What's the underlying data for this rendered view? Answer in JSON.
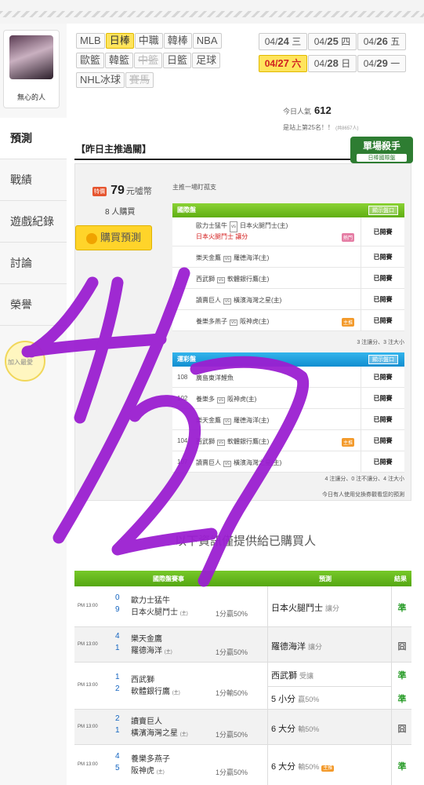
{
  "profile": {
    "name": "無心的人"
  },
  "sidebar": {
    "items": [
      "預測",
      "戰績",
      "遊戲紀錄",
      "討論",
      "榮譽"
    ]
  },
  "bulb_text": "加入最愛",
  "tags": [
    {
      "label": "MLB",
      "state": "normal"
    },
    {
      "label": "日棒",
      "state": "selected"
    },
    {
      "label": "中職",
      "state": "normal"
    },
    {
      "label": "韓棒",
      "state": "normal"
    },
    {
      "label": "NBA",
      "state": "normal"
    },
    {
      "label": "歐籃",
      "state": "normal"
    },
    {
      "label": "韓籃",
      "state": "normal"
    },
    {
      "label": "中籃",
      "state": "disabled"
    },
    {
      "label": "日籃",
      "state": "normal"
    },
    {
      "label": "足球",
      "state": "normal"
    },
    {
      "label": "NHL冰球",
      "state": "normal"
    },
    {
      "label": "賽馬",
      "state": "disabled"
    }
  ],
  "dates": [
    {
      "md": "04/",
      "d": "24",
      "w": "三",
      "sel": false
    },
    {
      "md": "04/",
      "d": "25",
      "w": "四",
      "sel": false
    },
    {
      "md": "04/",
      "d": "26",
      "w": "五",
      "sel": false
    },
    {
      "md": "04/",
      "d": "27",
      "w": "六",
      "sel": true
    },
    {
      "md": "04/",
      "d": "28",
      "w": "日",
      "sel": false
    },
    {
      "md": "04/",
      "d": "29",
      "w": "一",
      "sel": false
    }
  ],
  "popularity": {
    "label": "今日人氣",
    "value": "612"
  },
  "rank": {
    "text": "是站上第25名！！",
    "small": "(共8657人)"
  },
  "section_title": "【昨日主推過關】",
  "badge": {
    "line1": "單場殺手",
    "line2": "日棒國際盤"
  },
  "price": {
    "tag": "特價",
    "value": "79",
    "unit": "元噓幣"
  },
  "bought": "8 人購買",
  "buy_button": "購買預測",
  "intro": "主推一場盯孤支",
  "intl_table": {
    "title": "國際盤",
    "button": "顯示盤口",
    "rows": [
      {
        "away": "歐力士猛牛",
        "home": "日本火腿鬥士(主)",
        "pick": "日本火腿鬥士",
        "type": "讓分",
        "flag": "熱門",
        "status": "已開賽"
      },
      {
        "away": "樂天金鷹",
        "home": "羅德海洋(主)",
        "status": "已開賽"
      },
      {
        "away": "西武獅",
        "home": "軟體銀行鷹(主)",
        "status": "已開賽"
      },
      {
        "away": "讀賣巨人",
        "home": "橫濱海灣之星(主)",
        "status": "已開賽"
      },
      {
        "away": "養樂多燕子",
        "home": "阪神虎(主)",
        "flag": "主推",
        "status": "已開賽"
      }
    ],
    "note": "3 注讓分、3 注大小"
  },
  "lottery_table": {
    "title": "運彩盤",
    "button": "顯示盤口",
    "rows": [
      {
        "no": "108",
        "away": "廣島東洋鯉魚",
        "home": "",
        "status": "已開賽"
      },
      {
        "no": "102",
        "away": "養樂多",
        "home": "阪神虎(主)",
        "status": "已開賽"
      },
      {
        "no": "",
        "away": "樂天金鷹",
        "home": "羅德海洋(主)",
        "status": "已開賽"
      },
      {
        "no": "104",
        "away": "西武獅",
        "home": "軟體銀行鷹(主)",
        "flag": "主推",
        "status": "已開賽"
      },
      {
        "no": "107",
        "away": "讀賣巨人",
        "home": "橫濱海灣之星(主)",
        "status": "已開賽"
      }
    ],
    "note": "4 注讓分、0 注不讓分、4 注大小",
    "exchange_note": "今日有人使用兌換券觀看您的預測"
  },
  "subtitle": "以下資訊僅提供給已購買人",
  "result_table": {
    "headers": [
      "國際盤賽事",
      "預測",
      "結果"
    ],
    "groups": [
      {
        "time": "PM 13:00",
        "s1": "0",
        "t1": "歐力士猛牛",
        "s2": "9",
        "t2": "日本火腿鬥士",
        "home": "(主)",
        "line": "1分贏50%",
        "preds": [
          {
            "text": "日本火腿鬥士",
            "sub": "讓分",
            "result": "準",
            "ok": true
          }
        ]
      },
      {
        "time": "PM 13:00",
        "s1": "4",
        "t1": "樂天金鷹",
        "s2": "1",
        "t2": "羅德海洋",
        "home": "(主)",
        "line": "1分贏50%",
        "preds": [
          {
            "text": "羅德海洋",
            "sub": "讓分",
            "result": "囧",
            "ok": false
          }
        ]
      },
      {
        "time": "PM 13:00",
        "s1": "1",
        "t1": "西武獅",
        "s2": "2",
        "t2": "軟體銀行鷹",
        "home": "(主)",
        "line": "1分輸50%",
        "preds": [
          {
            "text": "西武獅",
            "sub": "受讓",
            "result": "準",
            "ok": true
          },
          {
            "text": "5 小分",
            "sub": "贏50%",
            "result": "準",
            "ok": true
          }
        ]
      },
      {
        "time": "PM 13:00",
        "s1": "2",
        "t1": "讀賣巨人",
        "s2": "1",
        "t2": "橫濱海灣之星",
        "home": "(主)",
        "line": "1分贏50%",
        "preds": [
          {
            "text": "6 大分",
            "sub": "輸50%",
            "result": "囧",
            "ok": false
          }
        ]
      },
      {
        "time": "PM 13:00",
        "s1": "4",
        "t1": "養樂多燕子",
        "s2": "5",
        "t2": "阪神虎",
        "home": "(主)",
        "line": "1分贏50%",
        "preds": [
          {
            "text": "6 大分",
            "sub": "輸50%",
            "result": "準",
            "ok": true,
            "flag": "主推"
          }
        ]
      }
    ]
  },
  "handwriting": {
    "text": "4/27",
    "color": "#9b1fd1"
  }
}
